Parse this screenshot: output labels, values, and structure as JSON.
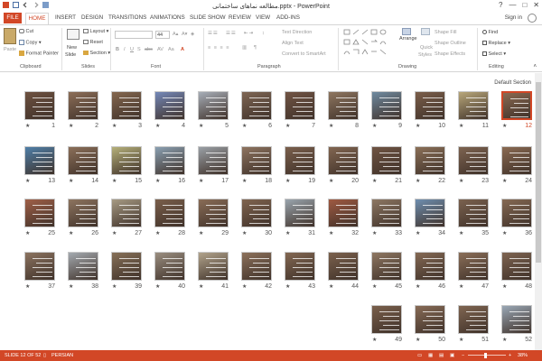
{
  "window": {
    "title": "مطالعه نماهای ساختمانی.pptx - PowerPoint",
    "help": "?",
    "minimize": "—",
    "maximize": "□",
    "close": "✕"
  },
  "tabs": [
    "FILE",
    "HOME",
    "INSERT",
    "DESIGN",
    "TRANSITIONS",
    "ANIMATIONS",
    "SLIDE SHOW",
    "REVIEW",
    "VIEW",
    "ADD-INS"
  ],
  "signin": "Sign in",
  "ribbon": {
    "clipboard": {
      "paste": "Paste",
      "cut": "Cut",
      "copy": "Copy",
      "format_painter": "Format Painter",
      "label": "Clipboard"
    },
    "slides": {
      "new_slide": "New",
      "new_slide2": "Slide",
      "layout": "Layout",
      "reset": "Reset",
      "section": "Section",
      "label": "Slides"
    },
    "font": {
      "size": "44",
      "label": "Font"
    },
    "paragraph": {
      "text_direction": "Text Direction",
      "align_text": "Align Text",
      "convert": "Convert to SmartArt",
      "label": "Paragraph"
    },
    "drawing": {
      "arrange": "Arrange",
      "quick_styles": "Quick",
      "quick_styles2": "Styles",
      "shape_fill": "Shape Fill",
      "shape_outline": "Shape Outline",
      "shape_effects": "Shape Effects",
      "label": "Drawing"
    },
    "editing": {
      "find": "Find",
      "replace": "Replace",
      "select": "Select",
      "label": "Editing"
    }
  },
  "section_label": "Default Section",
  "slides": [
    {
      "n": "12",
      "c": "#8a6a52",
      "selected": true
    },
    {
      "n": "11",
      "c": "#b8a77a"
    },
    {
      "n": "10",
      "c": "#7a5e4a"
    },
    {
      "n": "9",
      "c": "#6f8aa0"
    },
    {
      "n": "8",
      "c": "#8e7660"
    },
    {
      "n": "7",
      "c": "#705444"
    },
    {
      "n": "6",
      "c": "#7e6654"
    },
    {
      "n": "5",
      "c": "#a7aeb8"
    },
    {
      "n": "4",
      "c": "#7488b8"
    },
    {
      "n": "3",
      "c": "#84674f"
    },
    {
      "n": "2",
      "c": "#8c6e58"
    },
    {
      "n": "1",
      "c": "#6d5140"
    },
    {
      "n": "24",
      "c": "#8a6a52"
    },
    {
      "n": "23",
      "c": "#7d6350"
    },
    {
      "n": "22",
      "c": "#8b7058"
    },
    {
      "n": "21",
      "c": "#6f5443"
    },
    {
      "n": "20",
      "c": "#826651"
    },
    {
      "n": "19",
      "c": "#7a5f4c"
    },
    {
      "n": "18",
      "c": "#8e7460"
    },
    {
      "n": "17",
      "c": "#9aa0a6"
    },
    {
      "n": "16",
      "c": "#8aa0b2"
    },
    {
      "n": "15",
      "c": "#b5b07a"
    },
    {
      "n": "14",
      "c": "#8b6f59"
    },
    {
      "n": "13",
      "c": "#4f7fa8"
    },
    {
      "n": "36",
      "c": "#866a54"
    },
    {
      "n": "35",
      "c": "#7b624f"
    },
    {
      "n": "34",
      "c": "#6f8fb0"
    },
    {
      "n": "33",
      "c": "#8e7864"
    },
    {
      "n": "32",
      "c": "#a05a42"
    },
    {
      "n": "31",
      "c": "#9aa5ae"
    },
    {
      "n": "30",
      "c": "#806550"
    },
    {
      "n": "29",
      "c": "#8a6d57"
    },
    {
      "n": "28",
      "c": "#7a5f4b"
    },
    {
      "n": "27",
      "c": "#a79b84"
    },
    {
      "n": "26",
      "c": "#8e7560"
    },
    {
      "n": "25",
      "c": "#a06048"
    },
    {
      "n": "48",
      "c": "#7e6451"
    },
    {
      "n": "47",
      "c": "#8a6e58"
    },
    {
      "n": "46",
      "c": "#846954"
    },
    {
      "n": "45",
      "c": "#8e7762"
    },
    {
      "n": "44",
      "c": "#7b614d"
    },
    {
      "n": "43",
      "c": "#826752"
    },
    {
      "n": "42",
      "c": "#8c715b"
    },
    {
      "n": "41",
      "c": "#b2a48c"
    },
    {
      "n": "40",
      "c": "#9a8e80"
    },
    {
      "n": "39",
      "c": "#867058"
    },
    {
      "n": "38",
      "c": "#a4aab0"
    },
    {
      "n": "37",
      "c": "#8b7360"
    },
    {
      "n": "52",
      "c": "#9aa8b6"
    },
    {
      "n": "51",
      "c": "#7f6551"
    },
    {
      "n": "50",
      "c": "#876b56"
    },
    {
      "n": "49",
      "c": "#7a604c"
    }
  ],
  "status": {
    "slide_of": "SLIDE 12 OF 52",
    "language": "PERSIAN",
    "zoom": "38%",
    "zoom_fraction": 0.45
  },
  "colors": {
    "accent": "#d24726"
  }
}
